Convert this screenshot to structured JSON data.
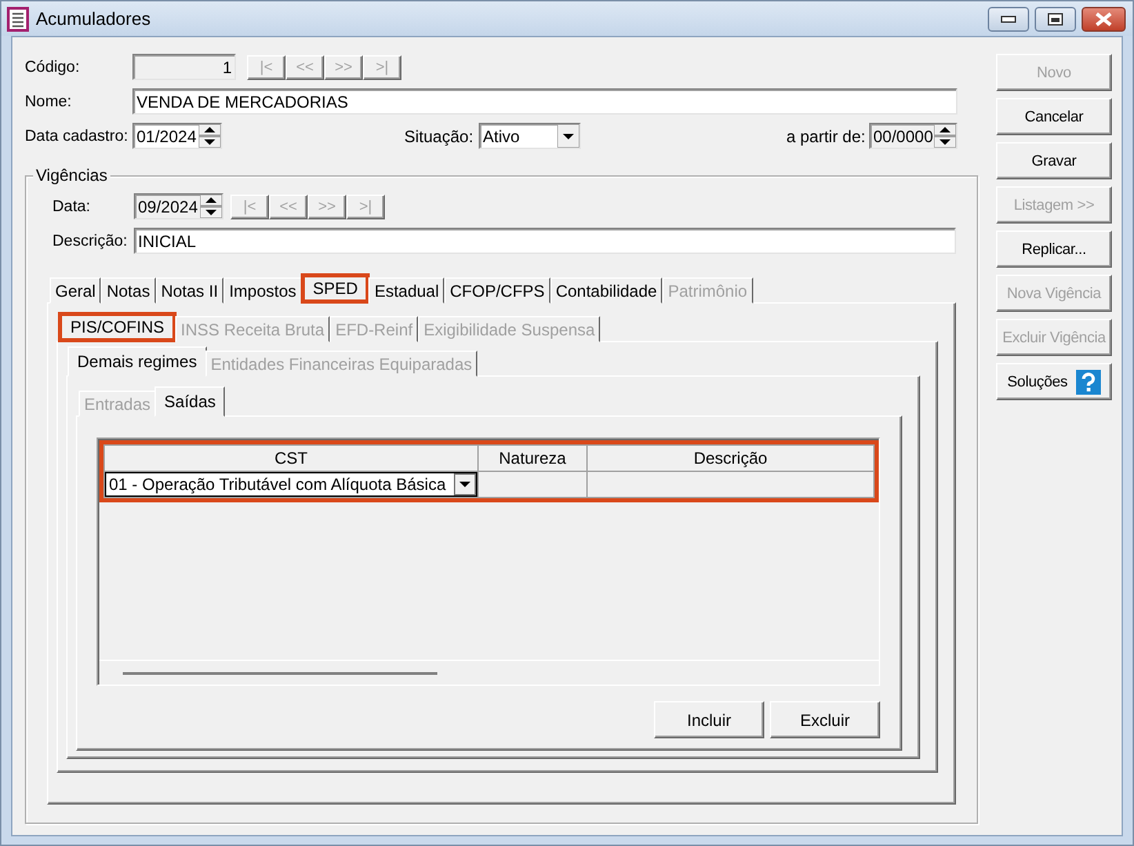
{
  "window": {
    "title": "Acumuladores"
  },
  "form": {
    "codigo": {
      "label": "Código:",
      "value": "1",
      "disabled": true
    },
    "record_nav": [
      {
        "label": "|<",
        "disabled": true
      },
      {
        "label": "<<",
        "disabled": true
      },
      {
        "label": ">>",
        "disabled": true
      },
      {
        "label": ">|",
        "disabled": true
      }
    ],
    "nome": {
      "label": "Nome:",
      "value": "VENDA DE MERCADORIAS"
    },
    "data_cadastro": {
      "label": "Data cadastro:",
      "value": "01/2024",
      "disabled": false
    },
    "situacao": {
      "label": "Situação:",
      "value": "Ativo"
    },
    "a_partir_de": {
      "label": "a partir de:",
      "value": "00/0000",
      "disabled": true
    }
  },
  "vigencias": {
    "title": "Vigências",
    "data": {
      "label": "Data:",
      "value": "09/2024",
      "disabled": true
    },
    "nav": [
      {
        "label": "|<",
        "disabled": true
      },
      {
        "label": "<<",
        "disabled": true
      },
      {
        "label": ">>",
        "disabled": true
      },
      {
        "label": ">|",
        "disabled": true
      }
    ],
    "descricao": {
      "label": "Descrição:",
      "value": "INICIAL"
    },
    "tabs": [
      {
        "label": "Geral",
        "selected": false,
        "disabled": false,
        "highlighted": false
      },
      {
        "label": "Notas",
        "selected": false,
        "disabled": false,
        "highlighted": false
      },
      {
        "label": "Notas II",
        "selected": false,
        "disabled": false,
        "highlighted": false
      },
      {
        "label": "Impostos",
        "selected": false,
        "disabled": false,
        "highlighted": false
      },
      {
        "label": "SPED",
        "selected": true,
        "disabled": false,
        "highlighted": true
      },
      {
        "label": "Estadual",
        "selected": false,
        "disabled": false,
        "highlighted": false
      },
      {
        "label": "CFOP/CFPS",
        "selected": false,
        "disabled": false,
        "highlighted": false
      },
      {
        "label": "Contabilidade",
        "selected": false,
        "disabled": false,
        "highlighted": false
      },
      {
        "label": "Patrimônio",
        "selected": false,
        "disabled": true,
        "highlighted": false
      }
    ],
    "sub_tabs": [
      {
        "label": "PIS/COFINS",
        "selected": true,
        "disabled": false,
        "highlighted": true
      },
      {
        "label": "INSS Receita Bruta",
        "selected": false,
        "disabled": true,
        "highlighted": false
      },
      {
        "label": "EFD-Reinf",
        "selected": false,
        "disabled": true,
        "highlighted": false
      },
      {
        "label": "Exigibilidade Suspensa",
        "selected": false,
        "disabled": true,
        "highlighted": false
      }
    ],
    "regime_tabs": [
      {
        "label": "Demais regimes",
        "selected": true,
        "disabled": false,
        "highlighted": false
      },
      {
        "label": "Entidades Financeiras Equiparadas",
        "selected": false,
        "disabled": true,
        "highlighted": false
      }
    ],
    "direction_tabs": [
      {
        "label": "Entradas",
        "selected": false,
        "disabled": true,
        "highlighted": false
      },
      {
        "label": "Saídas",
        "selected": true,
        "disabled": false,
        "highlighted": false
      }
    ],
    "grid": {
      "highlighted": true,
      "columns": [
        "CST",
        "Natureza",
        "Descrição"
      ],
      "rows": [
        {
          "cst": "01 - Operação Tributável com Alíquota Básica"
        }
      ],
      "buttons": [
        "Incluir",
        "Excluir"
      ]
    }
  },
  "side_buttons": [
    {
      "label": "Novo",
      "disabled": true,
      "kind": "plain"
    },
    {
      "label": "Cancelar",
      "disabled": false,
      "kind": "plain"
    },
    {
      "label": "Gravar",
      "disabled": false,
      "kind": "plain"
    },
    {
      "label": "Listagem >>",
      "disabled": true,
      "kind": "plain"
    },
    {
      "label": "Replicar...",
      "disabled": false,
      "kind": "plain"
    },
    {
      "label": "Nova Vigência",
      "disabled": true,
      "kind": "plain"
    },
    {
      "label": "Excluir Vigência",
      "disabled": true,
      "kind": "plain"
    },
    {
      "label": "Soluções",
      "disabled": false,
      "kind": "help"
    }
  ]
}
